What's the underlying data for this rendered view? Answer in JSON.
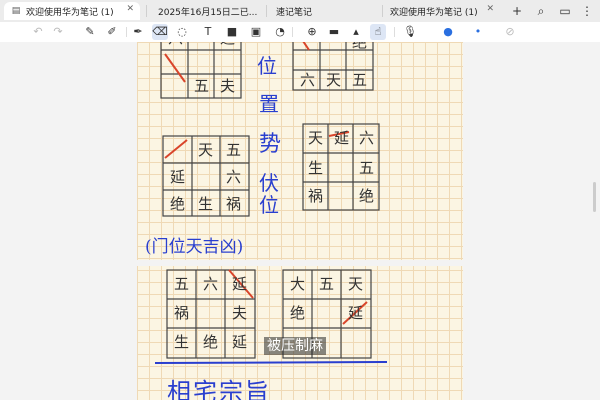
{
  "tabs": [
    {
      "label": "欢迎使用华为笔记 (1)",
      "icon": "notebook-icon",
      "active": true
    },
    {
      "label": "2025年16月15日二已...",
      "icon": "",
      "active": false
    },
    {
      "label": "速记笔记",
      "icon": "",
      "active": false
    },
    {
      "label": "欢迎使用华为笔记 (1)",
      "icon": "notebook-icon",
      "active": false
    }
  ],
  "window_buttons": {
    "add": "+",
    "search": "⌕",
    "sidebar": "▭",
    "more": "⋮"
  },
  "toolbar": {
    "undo": "↶",
    "redo": "↷",
    "pen": "✎",
    "pencil": "✐",
    "eraser": "⌫",
    "lasso": "◌",
    "text": "T",
    "shape": "■",
    "image": "▣",
    "sticker": "◔",
    "marker": "✒",
    "zoom": "⊕",
    "highlighter": "▬",
    "pin": "▴",
    "finger": "☝",
    "mic": "🎙",
    "record": "●",
    "dot": "•",
    "ban": "⊘"
  },
  "grids": {
    "g1": [
      [
        "六",
        "",
        "远"
      ],
      [
        "",
        "",
        ""
      ],
      [
        "",
        "五",
        "夫"
      ]
    ],
    "g2": [
      [
        "",
        "",
        "绝"
      ],
      [
        "",
        "",
        ""
      ],
      [
        "六",
        "天",
        "五"
      ]
    ],
    "g3": [
      [
        "",
        "天",
        "五"
      ],
      [
        "延",
        "",
        "六"
      ],
      [
        "绝",
        "生",
        "祸"
      ]
    ],
    "g4": [
      [
        "天",
        "延",
        "六"
      ],
      [
        "生",
        "",
        "五"
      ],
      [
        "祸",
        "",
        "绝"
      ]
    ],
    "g5": [
      [
        "五",
        "六",
        "延"
      ],
      [
        "祸",
        "",
        "夫"
      ],
      [
        "生",
        "绝",
        "延"
      ]
    ],
    "g6": [
      [
        "大",
        "五",
        "天"
      ],
      [
        "绝",
        "",
        "延"
      ],
      [
        "",
        "",
        ""
      ]
    ]
  },
  "handwriting": {
    "side_col1": "位",
    "side_col2": "置",
    "side_col3": "势",
    "side_col4": "伏位",
    "paren": "(门位天吉凶)",
    "bottom": "相宅宗旨"
  },
  "subtitle": "被压制麻",
  "colors": {
    "ink_blue": "#2a3fcf",
    "ink_red": "#d9452b",
    "paper": "#fbf5e3"
  }
}
